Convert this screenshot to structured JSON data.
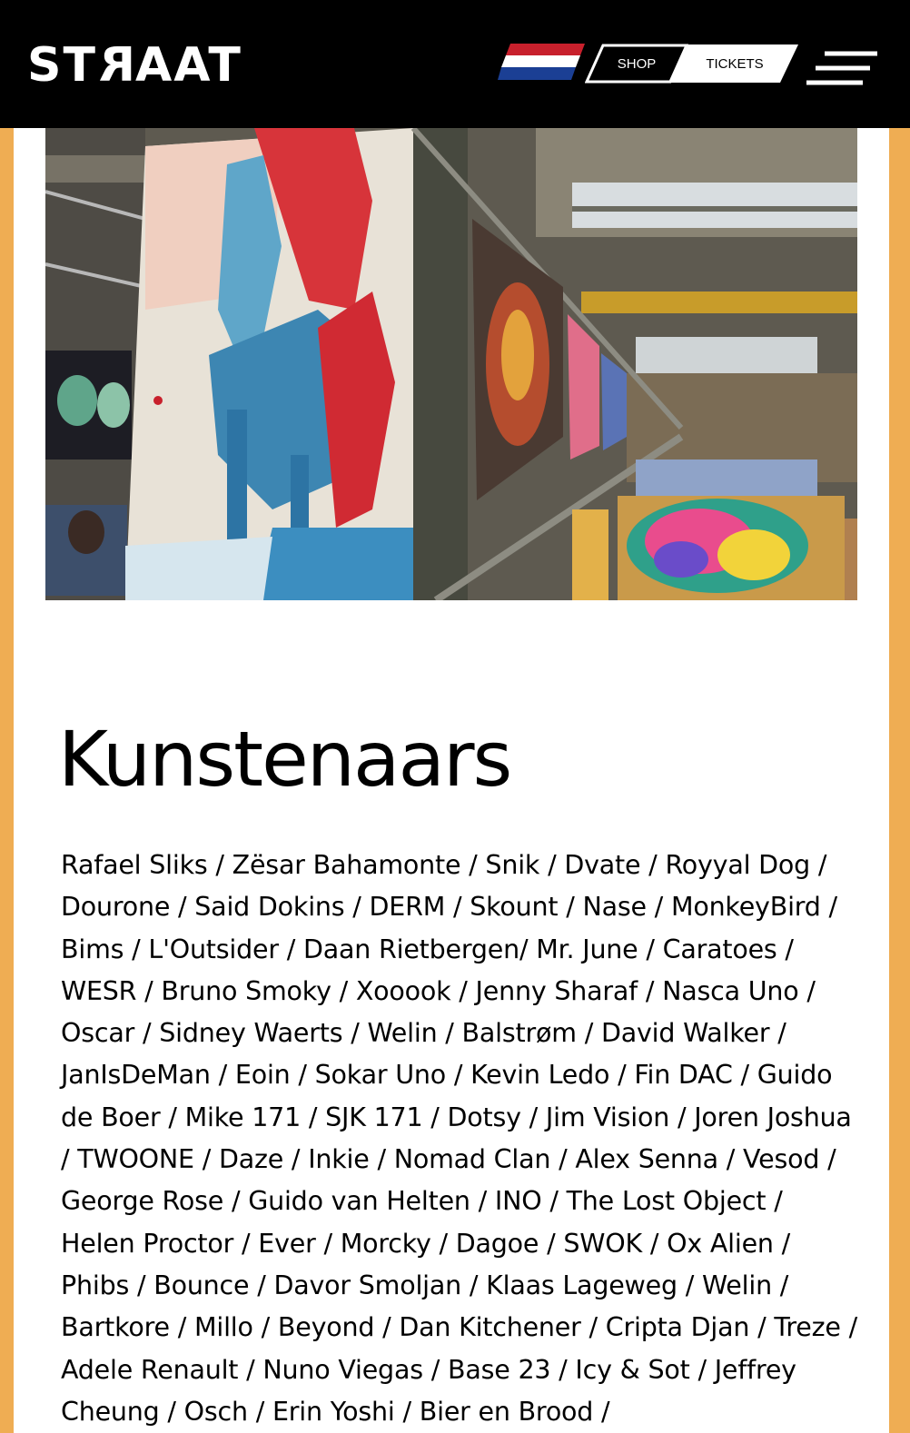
{
  "header": {
    "logo_text": "STRAAT",
    "flag": "netherlands-flag",
    "shop_label": "SHOP",
    "tickets_label": "TICKETS",
    "menu_icon": "hamburger-menu-icon"
  },
  "hero": {
    "image": "warehouse-gallery-with-murals-photo"
  },
  "main": {
    "title": "Kunstenaars",
    "artists_text": "Rafael Sliks / Zësar Bahamonte / Snik / Dvate / Royyal Dog / Dourone / Said Dokins / DERM / Skount / Nase / MonkeyBird / Bims / L'Outsider / Daan Rietbergen/ Mr. June / Caratoes / WESR / Bruno Smoky / Xooook / Jenny Sharaf / Nasca Uno / Oscar / Sidney Waerts / Welin / Balstrøm / David Walker / JanIsDeMan / Eoin / Sokar Uno / Kevin Ledo / Fin DAC / Guido de Boer / Mike 171 / SJK 171 / Dotsy / Jim Vision / Joren Joshua / TWOONE / Daze / Inkie / Nomad Clan / Alex Senna / Vesod / George Rose / Guido van Helten / INO / The Lost Object / Helen Proctor / Ever / Morcky / Dagoe / SWOK / Ox Alien / Phibs / Bounce / Davor Smoljan / Klaas Lageweg / Welin / Bartkore / Millo / Beyond / Dan Kitchener / Cripta Djan / Treze / Adele Renault / Nuno Viegas / Base 23 / Icy & Sot / Jeffrey Cheung / Osch / Erin Yoshi / Bier en Brood /"
  },
  "colors": {
    "header_bg": "#000000",
    "page_bg": "#efad53",
    "card_bg": "#ffffff"
  }
}
